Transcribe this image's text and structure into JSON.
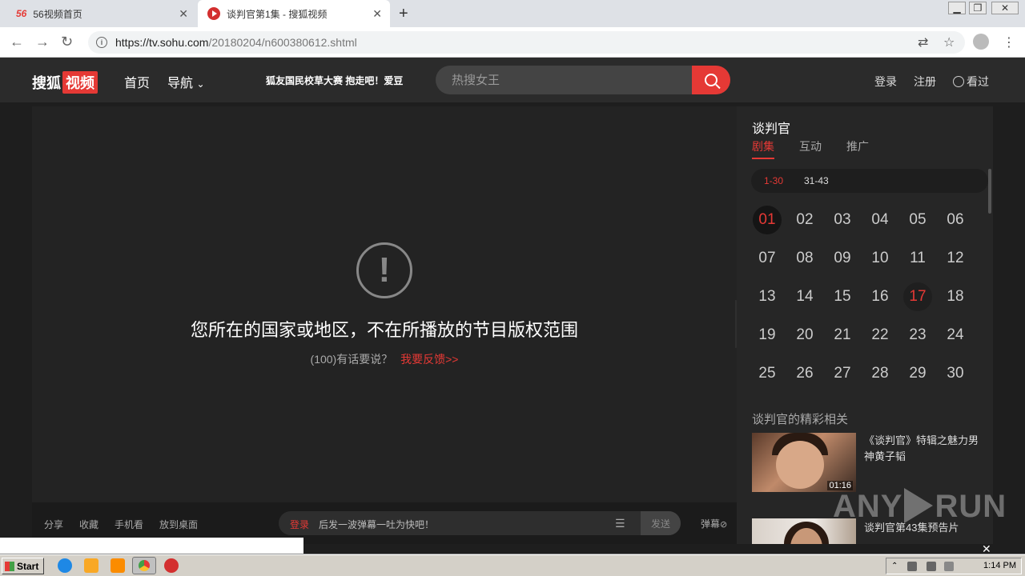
{
  "browser": {
    "tabs": [
      {
        "favicon": "56-logo",
        "title": "56视频首页"
      },
      {
        "favicon": "sohu-video-logo",
        "title": "谈判官第1集 - 搜狐视频"
      }
    ],
    "url_host": "https://tv.sohu.com",
    "url_rest": "/20180204/n600380612.shtml"
  },
  "header": {
    "logo_text": "搜狐",
    "logo_badge": "视频",
    "nav_home": "首页",
    "nav_guide": "导航",
    "promo": "狐友国民校草大赛  抱走吧！爱豆",
    "search_placeholder": "热搜女王",
    "login": "登录",
    "register": "注册",
    "history": "看过"
  },
  "player": {
    "error_message": "您所在的国家或地区，不在所播放的节目版权范围",
    "feedback_prefix": "(100)有话要说？",
    "feedback_link": "我要反馈>>",
    "bar": {
      "share": "分享",
      "favorite": "收藏",
      "mobile": "手机看",
      "desktop": "放到桌面",
      "danmu_login": "登录",
      "danmu_hint": "后发一波弹幕一吐为快吧！",
      "send": "发送",
      "danmu_toggle": "弹幕"
    }
  },
  "sidebar": {
    "title": "谈判官",
    "tabs": [
      "剧集",
      "互动",
      "推广"
    ],
    "active_tab": 0,
    "ranges": [
      "1-30",
      "31-43"
    ],
    "active_range": 0,
    "episodes": [
      "01",
      "02",
      "03",
      "04",
      "05",
      "06",
      "07",
      "08",
      "09",
      "10",
      "11",
      "12",
      "13",
      "14",
      "15",
      "16",
      "17",
      "18",
      "19",
      "20",
      "21",
      "22",
      "23",
      "24",
      "25",
      "26",
      "27",
      "28",
      "29",
      "30"
    ],
    "current_episode": "01",
    "highlighted_episode": "17",
    "related_title": "谈判官的精彩相关",
    "related": [
      {
        "title": "《谈判官》特辑之魅力男神黄子韬",
        "duration": "01:16"
      },
      {
        "title": "谈判官第43集预告片",
        "duration": ""
      }
    ]
  },
  "watermark": {
    "left": "ANY",
    "right": "RUN"
  },
  "taskbar": {
    "start": "Start",
    "time": "1:14 PM"
  }
}
